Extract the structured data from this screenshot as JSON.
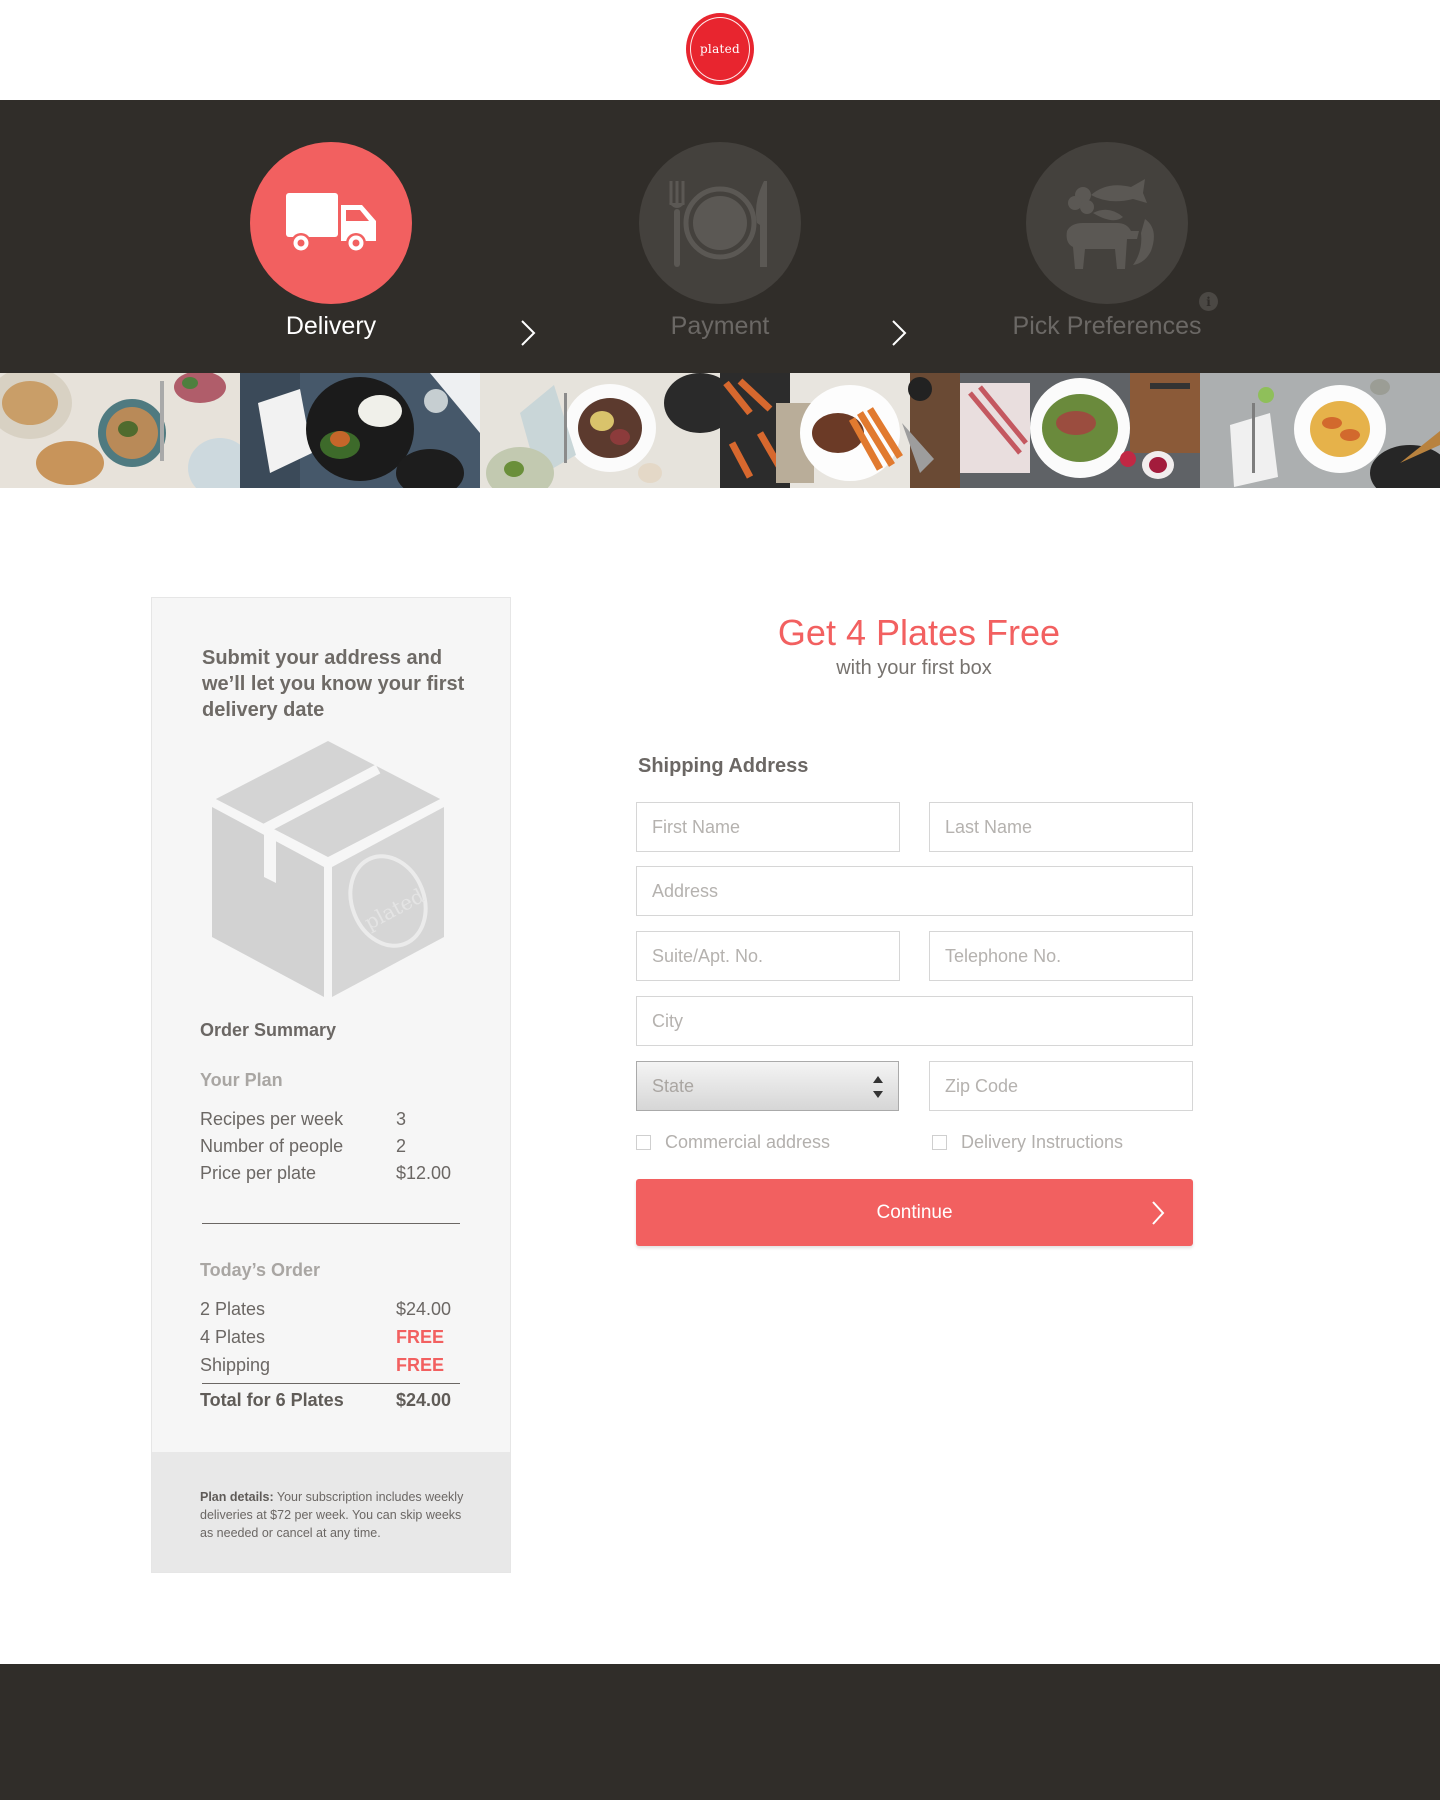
{
  "brand": {
    "logo_text": "plated",
    "accent": "#f26060",
    "logo_red": "#e8252f",
    "dark": "#302d29"
  },
  "steps": [
    {
      "label": "Delivery",
      "icon": "delivery-truck-icon",
      "active": true
    },
    {
      "label": "Payment",
      "icon": "plate-utensils-icon",
      "active": false
    },
    {
      "label": "Pick Preferences",
      "icon": "proteins-icon",
      "active": false
    }
  ],
  "info_icon": "i",
  "sidebar": {
    "intro": "Submit your address and we’ll let you know your first delivery date",
    "box_logo_text": "plated",
    "order_summary_title": "Order Summary",
    "your_plan": {
      "heading": "Your Plan",
      "rows": [
        {
          "label": "Recipes per week",
          "value": "3"
        },
        {
          "label": "Number of people",
          "value": "2"
        },
        {
          "label": "Price per plate",
          "value": "$12.00"
        }
      ]
    },
    "todays_order": {
      "heading": "Today’s Order",
      "rows": [
        {
          "label": "2 Plates",
          "value": "$24.00"
        },
        {
          "label": "4 Plates",
          "value": "FREE"
        },
        {
          "label": "Shipping",
          "value": "FREE"
        }
      ],
      "total_label": "Total for 6 Plates",
      "total_value": "$24.00"
    },
    "plan_details_label": "Plan details:",
    "plan_details_text": " Your subscription includes weekly deliveries at $72 per week. You can skip weeks as needed or cancel at any time."
  },
  "main": {
    "headline": "Get 4 Plates Free",
    "subhead": "with your first box",
    "form_title": "Shipping Address",
    "fields": {
      "first_name": {
        "placeholder": "First Name",
        "value": ""
      },
      "last_name": {
        "placeholder": "Last Name",
        "value": ""
      },
      "address": {
        "placeholder": "Address",
        "value": ""
      },
      "suite": {
        "placeholder": "Suite/Apt. No.",
        "value": ""
      },
      "telephone": {
        "placeholder": "Telephone No.",
        "value": ""
      },
      "city": {
        "placeholder": "City",
        "value": ""
      },
      "state": {
        "selected": "State"
      },
      "zip": {
        "placeholder": "Zip Code",
        "value": ""
      }
    },
    "checkboxes": {
      "commercial": "Commercial address",
      "delivery_instructions": "Delivery Instructions"
    },
    "continue_label": "Continue"
  }
}
